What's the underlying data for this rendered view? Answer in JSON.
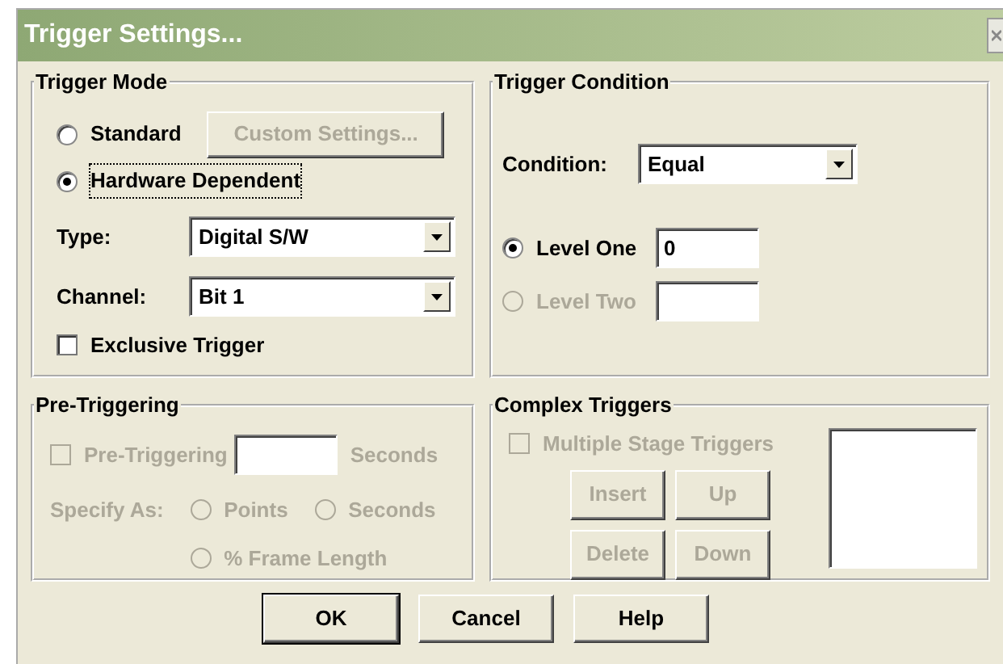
{
  "window": {
    "title": "Trigger Settings..."
  },
  "trigger_mode": {
    "title": "Trigger Mode",
    "options": [
      {
        "label": "Standard",
        "selected": false,
        "focused": false
      },
      {
        "label": "Hardware Dependent",
        "selected": true,
        "focused": true
      }
    ],
    "custom_settings": {
      "label": "Custom Settings...",
      "disabled": true
    },
    "type": {
      "label": "Type:",
      "value": "Digital S/W"
    },
    "channel": {
      "label": "Channel:",
      "value": "Bit 1"
    },
    "exclusive": {
      "label": "Exclusive Trigger",
      "checked": false
    }
  },
  "trigger_condition": {
    "title": "Trigger Condition",
    "condition": {
      "label": "Condition:",
      "value": "Equal"
    },
    "levels": [
      {
        "label": "Level One",
        "selected": true,
        "disabled": false,
        "value": "0"
      },
      {
        "label": "Level Two",
        "selected": false,
        "disabled": true
      }
    ]
  },
  "pre_triggering": {
    "title": "Pre-Triggering",
    "disabled": true,
    "checkbox": {
      "label": "Pre-Triggering",
      "checked": false
    },
    "unit": "Seconds",
    "specify_as": "Specify As:",
    "options": [
      {
        "label": "Points",
        "selected": false
      },
      {
        "label": "Seconds",
        "selected": false
      },
      {
        "label": "% Frame Length",
        "selected": false
      }
    ]
  },
  "complex_triggers": {
    "title": "Complex Triggers",
    "disabled": true,
    "checkbox": {
      "label": "Multiple Stage Triggers",
      "checked": false
    },
    "buttons": [
      {
        "label": "Insert"
      },
      {
        "label": "Up"
      },
      {
        "label": "Delete"
      },
      {
        "label": "Down"
      }
    ]
  },
  "buttons": [
    {
      "label": "OK",
      "default": true
    },
    {
      "label": "Cancel",
      "default": false
    },
    {
      "label": "Help",
      "default": false
    }
  ]
}
